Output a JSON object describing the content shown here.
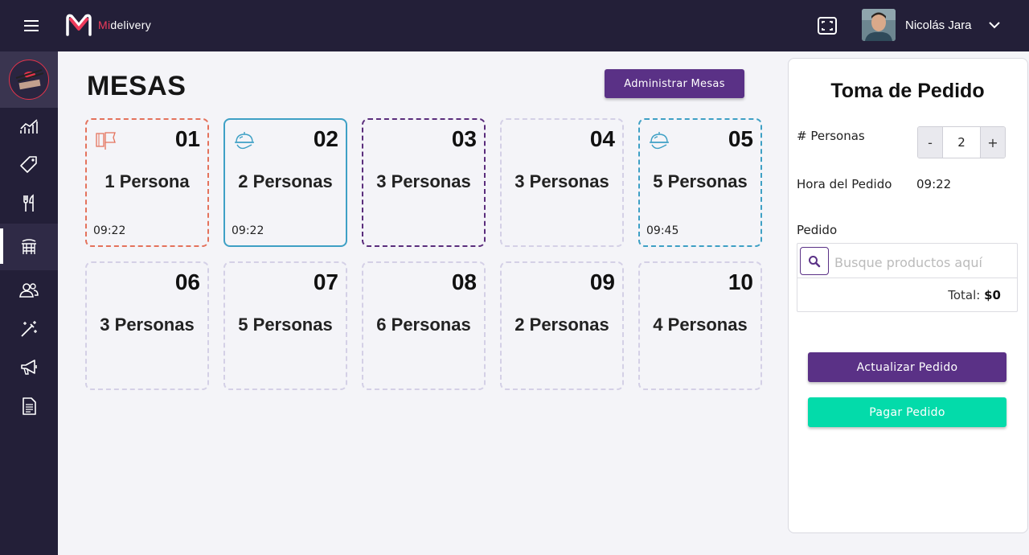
{
  "header": {
    "brand_prefix": "Mi",
    "brand_suffix": "delivery",
    "user_name": "Nicolás Jara",
    "menu_icon": "hamburger-icon",
    "scan_icon": "fullscreen-scan-icon",
    "chevron_icon": "chevron-down-icon"
  },
  "sidebar": {
    "items": [
      {
        "icon": "stats-chart-icon"
      },
      {
        "icon": "price-tag-icon"
      },
      {
        "icon": "fork-knife-icon"
      },
      {
        "icon": "dining-table-icon",
        "active": true
      },
      {
        "icon": "users-icon"
      },
      {
        "icon": "magic-wand-icon"
      },
      {
        "icon": "megaphone-icon"
      },
      {
        "icon": "receipt-icon"
      }
    ]
  },
  "main": {
    "title": "MESAS",
    "admin_button": "Administrar Mesas",
    "tables": [
      {
        "number": "01",
        "people": "1 Persona",
        "time": "09:22",
        "status": "orange",
        "icon": "order-ticket-icon"
      },
      {
        "number": "02",
        "people": "2 Personas",
        "time": "09:22",
        "status": "blue",
        "icon": "served-dish-icon"
      },
      {
        "number": "03",
        "people": "3 Personas",
        "time": "",
        "status": "purple"
      },
      {
        "number": "04",
        "people": "3 Personas",
        "time": "",
        "status": "free"
      },
      {
        "number": "05",
        "people": "5 Personas",
        "time": "09:45",
        "status": "bluedash",
        "icon": "served-dish-icon"
      },
      {
        "number": "06",
        "people": "3 Personas",
        "time": "",
        "status": "free"
      },
      {
        "number": "07",
        "people": "5 Personas",
        "time": "",
        "status": "free"
      },
      {
        "number": "08",
        "people": "6 Personas",
        "time": "",
        "status": "free"
      },
      {
        "number": "09",
        "people": "2 Personas",
        "time": "",
        "status": "free"
      },
      {
        "number": "10",
        "people": "4 Personas",
        "time": "",
        "status": "free"
      }
    ]
  },
  "order": {
    "title": "Toma de Pedido",
    "persons_label": "# Personas",
    "persons_value": "2",
    "minus": "-",
    "plus": "+",
    "time_label": "Hora del Pedido",
    "time_value": "09:22",
    "order_label": "Pedido",
    "search_placeholder": "Busque productos aquí",
    "total_label": "Total:",
    "total_value": "$0",
    "update_button": "Actualizar Pedido",
    "pay_button": "Pagar Pedido"
  },
  "colors": {
    "header_bg": "#231f38",
    "accent_purple": "#5a3186",
    "accent_green": "#03dbaa",
    "status_orange": "#e4725c",
    "status_blue": "#3ea0c5",
    "brand_red": "#ef3b5c"
  }
}
